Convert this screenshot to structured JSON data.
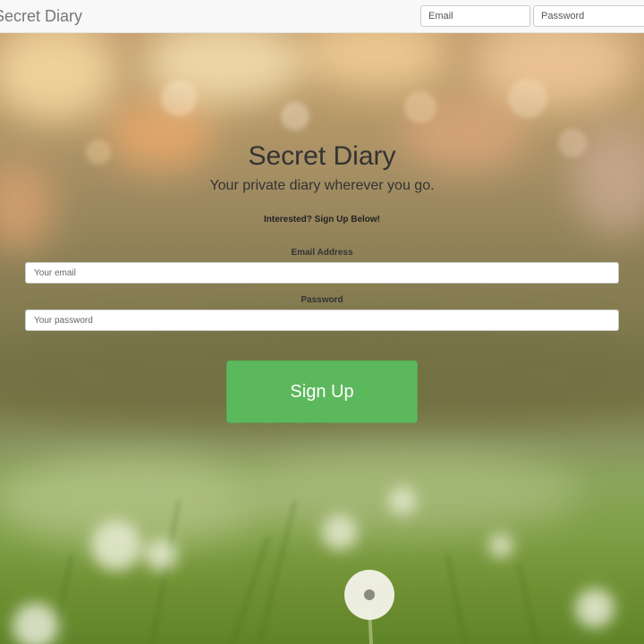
{
  "navbar": {
    "brand": "Secret Diary",
    "email_placeholder": "Email",
    "password_placeholder": "Password"
  },
  "hero": {
    "title": "Secret Diary",
    "subtitle": "Your private diary wherever you go.",
    "prompt": "Interested? Sign Up Below!"
  },
  "signup_form": {
    "email_label": "Email Address",
    "email_placeholder": "Your email",
    "password_label": "Password",
    "password_placeholder": "Your password",
    "submit_label": "Sign Up",
    "submit_color": "#5cb85c"
  }
}
